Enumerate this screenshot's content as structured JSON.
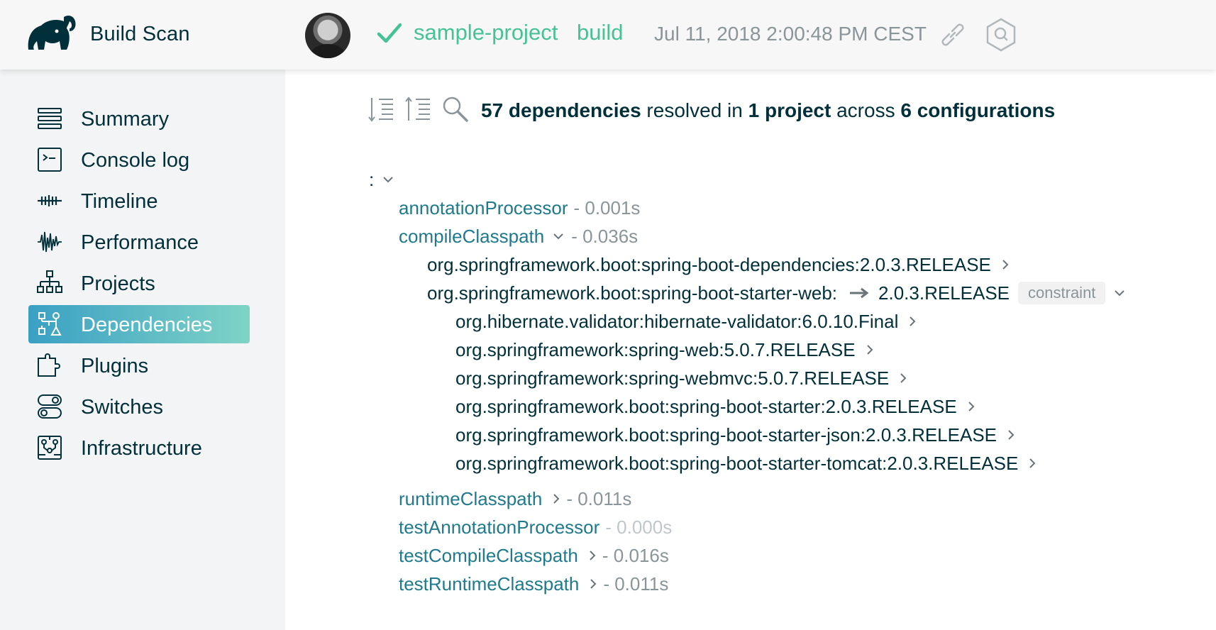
{
  "header": {
    "app_title": "Build Scan",
    "project": "sample-project",
    "task": "build",
    "timestamp": "Jul 11, 2018 2:00:48 PM CEST",
    "status": "success",
    "accent_color": "#47c296"
  },
  "sidebar": {
    "items": [
      {
        "label": "Summary",
        "icon": "list-icon",
        "active": false
      },
      {
        "label": "Console log",
        "icon": "terminal-icon",
        "active": false
      },
      {
        "label": "Timeline",
        "icon": "timeline-icon",
        "active": false
      },
      {
        "label": "Performance",
        "icon": "waveform-icon",
        "active": false
      },
      {
        "label": "Projects",
        "icon": "hierarchy-icon",
        "active": false
      },
      {
        "label": "Dependencies",
        "icon": "dependency-icon",
        "active": true
      },
      {
        "label": "Plugins",
        "icon": "puzzle-icon",
        "active": false
      },
      {
        "label": "Switches",
        "icon": "toggle-icon",
        "active": false
      },
      {
        "label": "Infrastructure",
        "icon": "circuit-icon",
        "active": false
      }
    ],
    "active_color_start": "#3aa0c4",
    "active_color_end": "#7fd3c6"
  },
  "main": {
    "summary": {
      "count": "57 dependencies",
      "t1": " resolved in ",
      "projects": "1 project",
      "t2": " across ",
      "configurations": "6 configurations"
    },
    "root": ":",
    "configurations": [
      {
        "name": "annotationProcessor",
        "duration": "- 0.001s"
      },
      {
        "name": "compileClasspath",
        "duration": "- 0.036s"
      },
      {
        "name": "runtimeClasspath",
        "duration": "- 0.011s"
      },
      {
        "name": "testAnnotationProcessor",
        "duration": "- 0.000s"
      },
      {
        "name": "testCompileClasspath",
        "duration": "- 0.016s"
      },
      {
        "name": "testRuntimeClasspath",
        "duration": "- 0.011s"
      }
    ],
    "compile_deps": [
      {
        "name": "org.springframework.boot:spring-boot-dependencies:2.0.3.RELEASE"
      },
      {
        "name": "org.springframework.boot:spring-boot-starter-web:",
        "resolved": "2.0.3.RELEASE",
        "badge": "constraint"
      }
    ],
    "web_children": [
      {
        "name": "org.hibernate.validator:hibernate-validator:6.0.10.Final"
      },
      {
        "name": "org.springframework:spring-web:5.0.7.RELEASE"
      },
      {
        "name": "org.springframework:spring-webmvc:5.0.7.RELEASE"
      },
      {
        "name": "org.springframework.boot:spring-boot-starter:2.0.3.RELEASE"
      },
      {
        "name": "org.springframework.boot:spring-boot-starter-json:2.0.3.RELEASE"
      },
      {
        "name": "org.springframework.boot:spring-boot-starter-tomcat:2.0.3.RELEASE"
      }
    ]
  }
}
